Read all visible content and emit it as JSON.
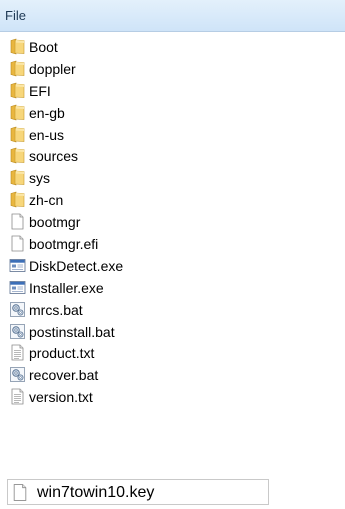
{
  "header": {
    "column_label": "File"
  },
  "files": [
    {
      "name": "Boot",
      "icon": "folder-icon"
    },
    {
      "name": "doppler",
      "icon": "folder-icon"
    },
    {
      "name": "EFI",
      "icon": "folder-icon"
    },
    {
      "name": "en-gb",
      "icon": "folder-icon"
    },
    {
      "name": "en-us",
      "icon": "folder-icon"
    },
    {
      "name": "sources",
      "icon": "folder-icon"
    },
    {
      "name": "sys",
      "icon": "folder-icon"
    },
    {
      "name": "zh-cn",
      "icon": "folder-icon"
    },
    {
      "name": "bootmgr",
      "icon": "blank-file-icon"
    },
    {
      "name": "bootmgr.efi",
      "icon": "blank-file-icon"
    },
    {
      "name": "DiskDetect.exe",
      "icon": "application-icon"
    },
    {
      "name": "Installer.exe",
      "icon": "application-icon"
    },
    {
      "name": "mrcs.bat",
      "icon": "batch-file-icon"
    },
    {
      "name": "postinstall.bat",
      "icon": "batch-file-icon"
    },
    {
      "name": "product.txt",
      "icon": "text-file-icon"
    },
    {
      "name": "recover.bat",
      "icon": "batch-file-icon"
    },
    {
      "name": "version.txt",
      "icon": "text-file-icon"
    }
  ],
  "rename": {
    "name": "win7towin10.key",
    "icon": "blank-file-icon"
  },
  "colors": {
    "header_bg": "#cfe4f8",
    "folder": "#f2c85b",
    "app_titlebar": "#3c6fb8"
  }
}
